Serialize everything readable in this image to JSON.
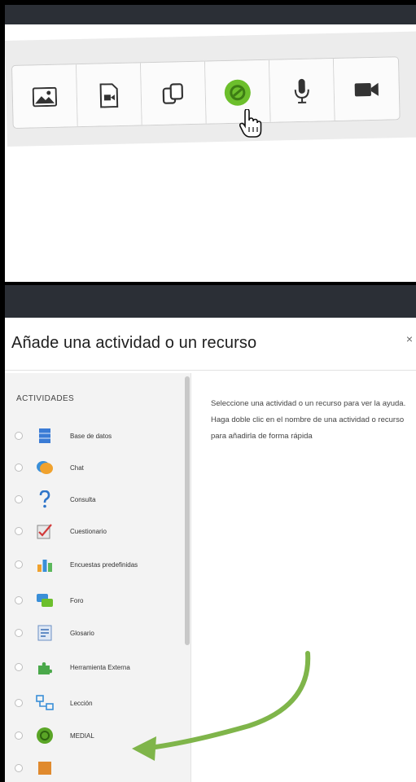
{
  "toolbar": {
    "buttons": [
      {
        "name": "image-button",
        "icon": "image-icon"
      },
      {
        "name": "media-button",
        "icon": "video-file-icon"
      },
      {
        "name": "manage-files-button",
        "icon": "copy-files-icon"
      },
      {
        "name": "medial-button",
        "icon": "medial-icon",
        "accent": "#6cbf2c"
      },
      {
        "name": "record-audio-button",
        "icon": "microphone-icon"
      },
      {
        "name": "record-video-button",
        "icon": "camera-icon"
      }
    ]
  },
  "dialog": {
    "title": "Añade una actividad o un recurso",
    "close_label": "×",
    "section_header": "ACTIVIDADES",
    "activities": [
      {
        "label": "Base de datos",
        "icon": "database-icon"
      },
      {
        "label": "Chat",
        "icon": "chat-icon"
      },
      {
        "label": "Consulta",
        "icon": "question-icon"
      },
      {
        "label": "Cuestionario",
        "icon": "quiz-icon"
      },
      {
        "label": "Encuestas predefinidas",
        "icon": "survey-chart-icon"
      },
      {
        "label": "Foro",
        "icon": "forum-icon"
      },
      {
        "label": "Glosario",
        "icon": "glossary-icon"
      },
      {
        "label": "Herramienta Externa",
        "icon": "puzzle-icon"
      },
      {
        "label": "Lección",
        "icon": "lesson-icon"
      },
      {
        "label": "MEDIAL",
        "icon": "medial-icon"
      }
    ],
    "help_text": "Seleccione una actividad o un recurso para ver la ayuda. Haga doble clic en el nombre de una actividad o recurso para añadirla de forma rápida"
  },
  "colors": {
    "dark_bar": "#2b2f36",
    "medial_green": "#6cbf2c",
    "arrow_green": "#7fb54a"
  }
}
